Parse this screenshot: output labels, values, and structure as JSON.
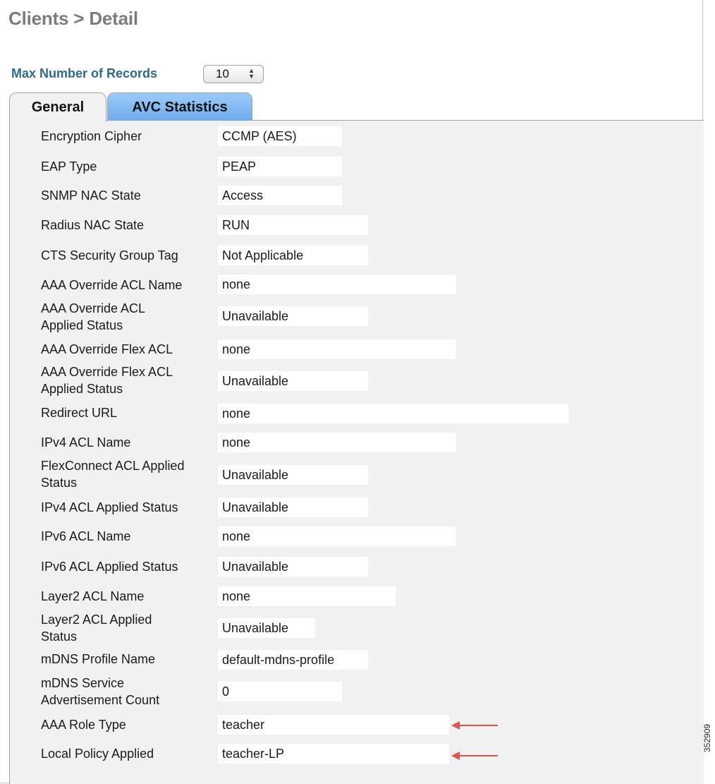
{
  "header": {
    "title": "Clients > Detail"
  },
  "records": {
    "label": "Max Number of Records",
    "value": "10"
  },
  "tabs": [
    {
      "label": "General",
      "active": true
    },
    {
      "label": "AVC Statistics",
      "active": false
    }
  ],
  "fields": [
    {
      "label": "Encryption Cipher",
      "value": "CCMP (AES)"
    },
    {
      "label": "EAP Type",
      "value": "PEAP"
    },
    {
      "label": "SNMP NAC State",
      "value": "Access"
    },
    {
      "label": "Radius NAC State",
      "value": "RUN"
    },
    {
      "label": "CTS Security Group Tag",
      "value": "Not Applicable"
    },
    {
      "label": "AAA Override ACL Name",
      "value": "none"
    },
    {
      "label": "AAA Override ACL\nApplied Status",
      "value": "Unavailable"
    },
    {
      "label": "AAA Override Flex ACL",
      "value": "none"
    },
    {
      "label": "AAA Override Flex ACL\nApplied Status",
      "value": "Unavailable"
    },
    {
      "label": "Redirect URL",
      "value": "none"
    },
    {
      "label": "IPv4 ACL Name",
      "value": "none"
    },
    {
      "label": "FlexConnect ACL Applied\nStatus",
      "value": "Unavailable"
    },
    {
      "label": "IPv4 ACL Applied Status",
      "value": "Unavailable"
    },
    {
      "label": "IPv6 ACL Name",
      "value": "none"
    },
    {
      "label": "IPv6 ACL Applied Status",
      "value": "Unavailable"
    },
    {
      "label": "Layer2 ACL Name",
      "value": "none"
    },
    {
      "label": "Layer2 ACL Applied\nStatus",
      "value": "Unavailable"
    },
    {
      "label": "mDNS Profile Name",
      "value": "default-mdns-profile"
    },
    {
      "label": "mDNS Service\nAdvertisement Count",
      "value": "0"
    },
    {
      "label": "AAA Role Type",
      "value": "teacher"
    },
    {
      "label": "Local Policy Applied",
      "value": "teacher-LP"
    }
  ],
  "figure_id": "352909",
  "colors": {
    "accent_label": "#2d6a8f",
    "arrow": "#e0554b",
    "tab_active": "#6eacec"
  }
}
